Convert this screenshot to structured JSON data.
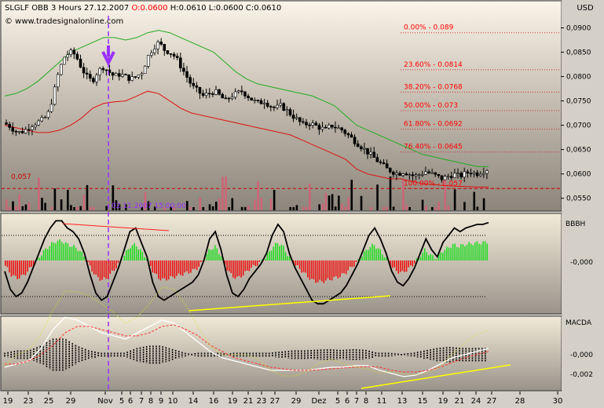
{
  "header": {
    "symbol": "SLGLF",
    "exchange": "OBB",
    "timeframe": "3 Hours",
    "date": "27.12.2007",
    "o_label": "O:",
    "o_value": "0.0600",
    "h_label": "H:0.0610",
    "l_label": "L:0.0600",
    "c_label": "C:0.0610",
    "copyright": "© www.tradesignalonline.com"
  },
  "panels": {
    "price_axis_title": "USD",
    "bbbh_title": "BBBH",
    "macda_title": "MACDA",
    "bbbh_zero": "-0,000",
    "macda_ticks": [
      "-0,000",
      "-0,002"
    ]
  },
  "colors": {
    "up_red": "#ff0000",
    "green": "#00cc00",
    "purple": "#9b30ff",
    "yellow": "#ffff00",
    "pink": "#cc6677"
  },
  "annotations": {
    "hline_label": "0,057",
    "marker_time": "02.11.2007 15:00:00"
  },
  "chart_data": [
    {
      "type": "candlestick",
      "title": "SLGLF OBB 3 Hours 27.12.2007",
      "yaxis_ticks": [
        "0,0900",
        "0,0850",
        "0,0800",
        "0,0750",
        "0,0700",
        "0,0650",
        "0,0600",
        "0,0550"
      ],
      "ylim": [
        0.0535,
        0.0925
      ],
      "fibonacci": [
        {
          "label": "0.00% - 0.089",
          "value": 0.089
        },
        {
          "label": "23.60% - 0.0814",
          "value": 0.0814
        },
        {
          "label": "38.20% - 0.0768",
          "value": 0.0768
        },
        {
          "label": "50.00% - 0.073",
          "value": 0.073
        },
        {
          "label": "61.80% - 0.0692",
          "value": 0.0692
        },
        {
          "label": "76.40% - 0.0645",
          "value": 0.0645
        },
        {
          "label": "100.00% - 0.057",
          "value": 0.057
        }
      ],
      "horizontal_line": 0.057,
      "x_tick_labels": [
        "19",
        "23",
        "25",
        "29",
        "Nov",
        "5",
        "6",
        "7",
        "8",
        "9",
        "10",
        "14",
        "16",
        "19",
        "21",
        "23",
        "27",
        "29",
        "Dez",
        "5",
        "6",
        "7",
        "8",
        "11",
        "13",
        "15",
        "19",
        "21",
        "24",
        "27",
        "28",
        "30"
      ],
      "price_path": [
        0.0705,
        0.07,
        0.069,
        0.0685,
        0.069,
        0.07,
        0.0705,
        0.071,
        0.072,
        0.076,
        0.081,
        0.084,
        0.085,
        0.0845,
        0.082,
        0.08,
        0.079,
        0.081,
        0.082,
        0.081,
        0.08,
        0.0805,
        0.08,
        0.0795,
        0.08,
        0.081,
        0.084,
        0.086,
        0.087,
        0.0855,
        0.085,
        0.084,
        0.082,
        0.08,
        0.078,
        0.077,
        0.076,
        0.0765,
        0.077,
        0.076,
        0.075,
        0.076,
        0.0765,
        0.077,
        0.076,
        0.075,
        0.0745,
        0.075,
        0.074,
        0.0735,
        0.074,
        0.073,
        0.072,
        0.071,
        0.07,
        0.0705,
        0.07,
        0.0695,
        0.069,
        0.07,
        0.0695,
        0.069,
        0.068,
        0.067,
        0.066,
        0.065,
        0.064,
        0.063,
        0.062,
        0.061,
        0.0605,
        0.06,
        0.0605,
        0.06,
        0.0595,
        0.06,
        0.0605,
        0.06,
        0.0595,
        0.059,
        0.0595,
        0.06,
        0.0595,
        0.06,
        0.0605,
        0.06,
        0.0605,
        0.061
      ],
      "bollinger_upper": [
        0.076,
        0.0765,
        0.0775,
        0.079,
        0.081,
        0.083,
        0.085,
        0.086,
        0.087,
        0.088,
        0.088,
        0.0875,
        0.088,
        0.089,
        0.0895,
        0.089,
        0.088,
        0.087,
        0.086,
        0.085,
        0.083,
        0.081,
        0.0795,
        0.0785,
        0.078,
        0.0775,
        0.077,
        0.0765,
        0.076,
        0.075,
        0.074,
        0.072,
        0.07,
        0.069,
        0.068,
        0.067,
        0.066,
        0.065,
        0.064,
        0.0635,
        0.063,
        0.0625,
        0.062,
        0.0615,
        0.0615
      ],
      "bollinger_lower": [
        0.07,
        0.0695,
        0.069,
        0.0685,
        0.0685,
        0.069,
        0.07,
        0.0715,
        0.0735,
        0.0745,
        0.0748,
        0.075,
        0.076,
        0.077,
        0.0765,
        0.075,
        0.0735,
        0.0725,
        0.072,
        0.0715,
        0.071,
        0.0705,
        0.07,
        0.0695,
        0.069,
        0.0685,
        0.068,
        0.067,
        0.066,
        0.065,
        0.064,
        0.063,
        0.061,
        0.06,
        0.0595,
        0.059,
        0.059,
        0.0585,
        0.058,
        0.0578,
        0.0576,
        0.0575,
        0.0574,
        0.0573,
        0.0573
      ]
    },
    {
      "type": "oscillator-histogram",
      "title": "BBBH",
      "series": [
        {
          "name": "BBBH",
          "values": [
            -0.3,
            -0.8,
            -1.0,
            -0.9,
            -0.6,
            -0.2,
            0.2,
            0.6,
            0.9,
            1.1,
            1.1,
            0.9,
            0.8,
            0.6,
            0.2,
            -0.4,
            -0.9,
            -1.1,
            -1.0,
            -0.6,
            -0.2,
            0.3,
            0.8,
            0.9,
            0.5,
            0.1,
            -0.6,
            -1.0,
            -1.1,
            -1.0,
            -0.9,
            -0.8,
            -0.7,
            -0.6,
            -0.4,
            0.0,
            0.6,
            0.8,
            0.3,
            -0.4,
            -0.9,
            -1.0,
            -0.8,
            -0.5,
            -0.3,
            -0.1,
            0.2,
            0.7,
            1.0,
            0.8,
            0.2,
            -0.2,
            -0.5,
            -0.8,
            -1.1,
            -1.2,
            -1.2,
            -1.1,
            -1.0,
            -0.9,
            -0.7,
            -0.4,
            -0.1,
            0.3,
            0.7,
            0.9,
            0.6,
            0.2,
            -0.3,
            -0.6,
            -0.7,
            -0.5,
            -0.2,
            0.2,
            0.6,
            0.3,
            0.1,
            0.5,
            0.7,
            0.9,
            0.8,
            0.9,
            0.95,
            1.0,
            1.0,
            1.05
          ]
        }
      ]
    },
    {
      "type": "macd",
      "title": "MACDA",
      "series": [
        {
          "name": "MACD",
          "values": [
            -0.4,
            -0.3,
            -0.2,
            0.2,
            0.8,
            1.2,
            1.1,
            0.9,
            0.7,
            0.6,
            0.5,
            0.7,
            0.9,
            1.1,
            1.0,
            0.7,
            0.4,
            0.1,
            -0.1,
            -0.2,
            -0.3,
            -0.4,
            -0.5,
            -0.5,
            -0.5,
            -0.5,
            -0.45,
            -0.4,
            -0.4,
            -0.35,
            -0.35,
            -0.5,
            -0.6,
            -0.7,
            -0.65,
            -0.5,
            -0.3,
            -0.1,
            0.0,
            0.1,
            0.2
          ]
        },
        {
          "name": "Signal",
          "values": [
            -0.3,
            -0.3,
            -0.2,
            0.0,
            0.3,
            0.7,
            0.9,
            0.9,
            0.8,
            0.7,
            0.6,
            0.6,
            0.7,
            0.9,
            0.95,
            0.8,
            0.6,
            0.3,
            0.1,
            -0.1,
            -0.2,
            -0.3,
            -0.4,
            -0.45,
            -0.5,
            -0.5,
            -0.48,
            -0.45,
            -0.42,
            -0.4,
            -0.38,
            -0.4,
            -0.5,
            -0.55,
            -0.55,
            -0.5,
            -0.4,
            -0.25,
            -0.1,
            0.0,
            0.1
          ]
        }
      ]
    }
  ]
}
